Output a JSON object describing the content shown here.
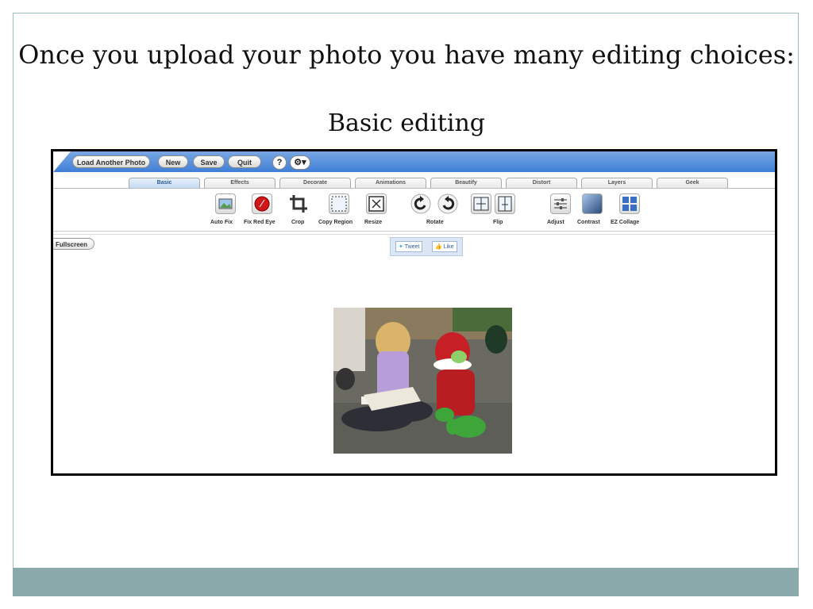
{
  "slide": {
    "heading": "Once you upload your photo you have many editing choices:",
    "subheading": "Basic editing",
    "footer_color": "#8aa9aa"
  },
  "app": {
    "top_buttons": {
      "load_another": "Load Another Photo",
      "new": "New",
      "save": "Save",
      "quit": "Quit",
      "help": "?",
      "settings_icon": "gear-icon"
    },
    "tabs": [
      {
        "label": "Basic",
        "active": true
      },
      {
        "label": "Effects",
        "active": false
      },
      {
        "label": "Decorate",
        "active": false
      },
      {
        "label": "Animations",
        "active": false
      },
      {
        "label": "Beautify",
        "active": false
      },
      {
        "label": "Distort",
        "active": false
      },
      {
        "label": "Layers",
        "active": false
      },
      {
        "label": "Geek",
        "active": false
      }
    ],
    "tools": {
      "auto_fix": "Auto Fix",
      "fix_red_eye": "Fix Red Eye",
      "crop": "Crop",
      "copy_region": "Copy Region",
      "resize": "Resize",
      "rotate": "Rotate",
      "flip": "Flip",
      "adjust": "Adjust",
      "contrast": "Contrast",
      "ez_collage": "EZ Collage"
    },
    "fullscreen_label": "Fullscreen",
    "social": {
      "tweet": "Tweet",
      "like": "Like"
    },
    "accent_color": "#3f7fd6"
  }
}
